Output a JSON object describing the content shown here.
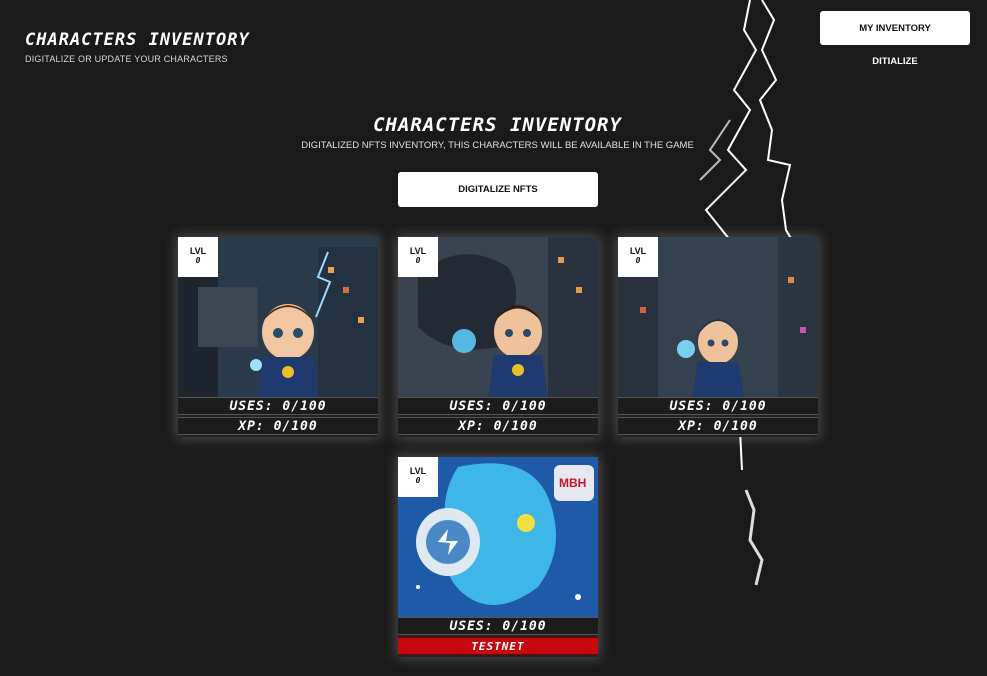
{
  "header": {
    "title": "CHARACTERS INVENTORY",
    "subtitle": "DIGITALIZE OR UPDATE YOUR CHARACTERS"
  },
  "nav": {
    "inventory_label": "MY INVENTORY",
    "digitalize_label": "DITIALIZE"
  },
  "section": {
    "title": "CHARACTERS INVENTORY",
    "subtitle": "DIGITALIZED NFTS INVENTORY, THIS CHARACTERS WILL BE AVAILABLE IN THE GAME",
    "button_label": "DIGITALIZE NFTS"
  },
  "cards": [
    {
      "lvl_label": "LVL",
      "lvl": "0",
      "uses": "USES: 0/100",
      "xp": "XP: 0/100"
    },
    {
      "lvl_label": "LVL",
      "lvl": "0",
      "uses": "USES: 0/100",
      "xp": "XP: 0/100"
    },
    {
      "lvl_label": "LVL",
      "lvl": "0",
      "uses": "USES: 0/100",
      "xp": "XP: 0/100"
    },
    {
      "lvl_label": "LVL",
      "lvl": "0",
      "uses": "USES: 0/100",
      "status": "TESTNET"
    }
  ],
  "colors": {
    "background": "#1a1a1a",
    "accent": "#ffffff",
    "testnet": "#c8080f"
  }
}
